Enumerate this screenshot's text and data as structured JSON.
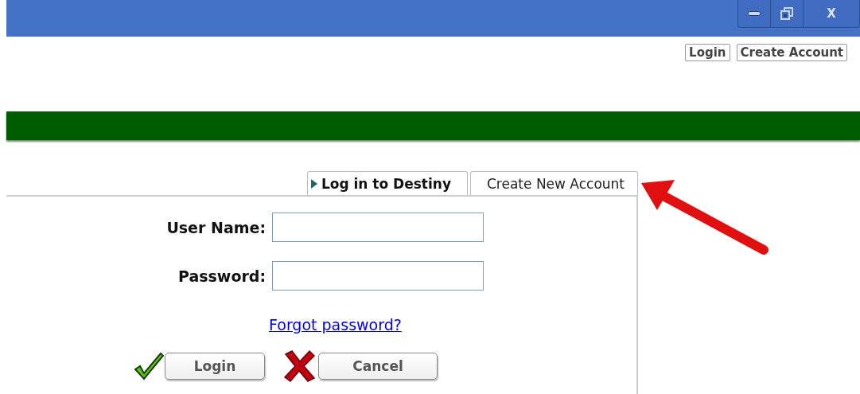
{
  "window": {
    "close_label": "X"
  },
  "top_links": [
    "Login",
    "Create Account"
  ],
  "tabs": [
    {
      "label": "Log in to Destiny",
      "selected": true
    },
    {
      "label": "Create New Account",
      "selected": false
    }
  ],
  "fields": [
    {
      "label": "User Name:"
    },
    {
      "label": "Password:"
    }
  ],
  "forgot_link": "Forgot password?",
  "buttons": [
    {
      "label": "Login",
      "kind": "confirm"
    },
    {
      "label": "Cancel",
      "kind": "cancel"
    }
  ]
}
